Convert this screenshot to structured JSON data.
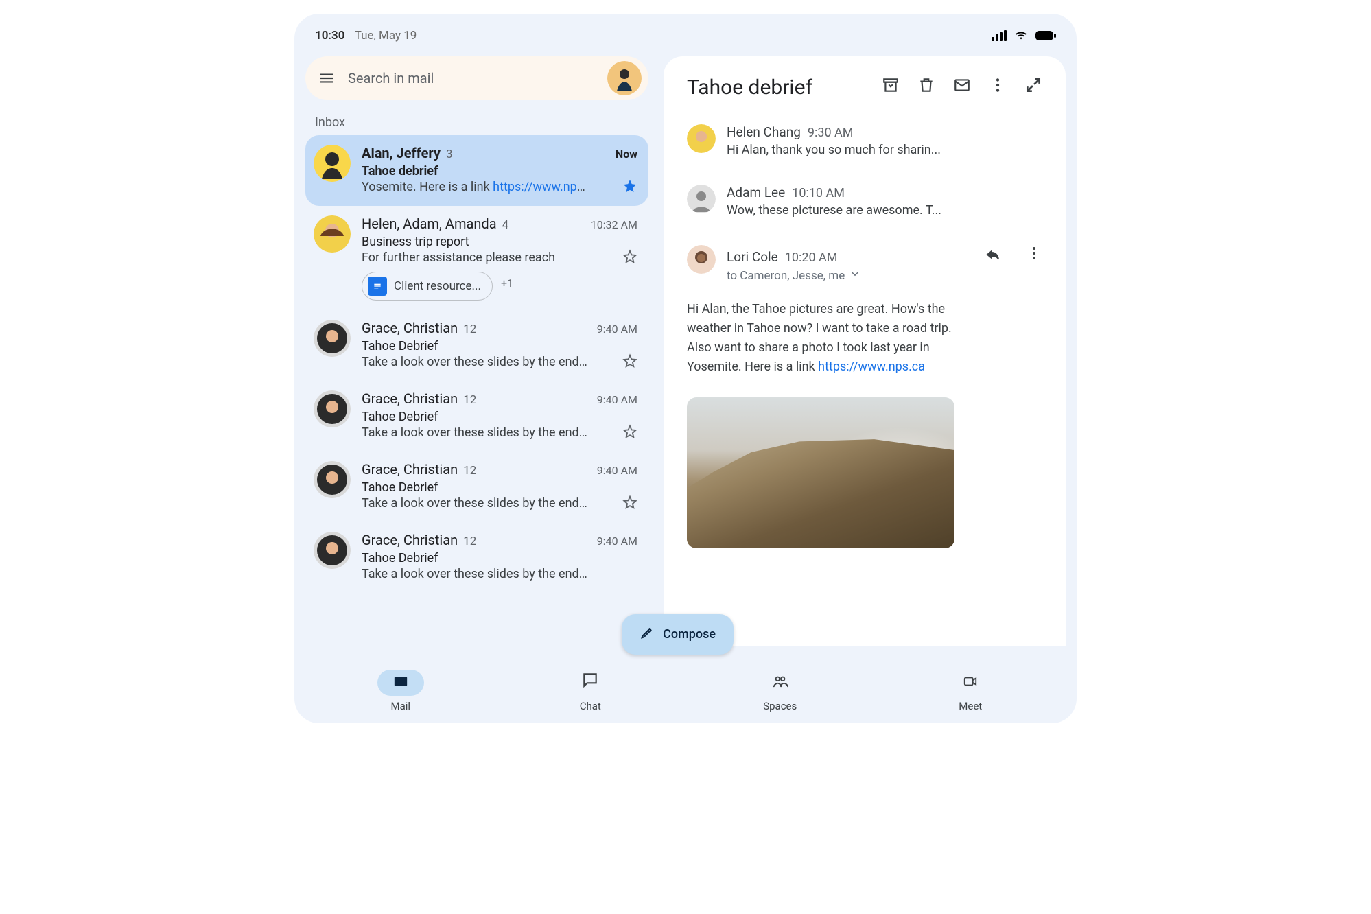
{
  "status": {
    "time": "10:30",
    "date": "Tue, May 19"
  },
  "search": {
    "placeholder": "Search in mail"
  },
  "section": "Inbox",
  "compose": "Compose",
  "threads": [
    {
      "names": "Alan, Jeffery",
      "count": "3",
      "subject": "Tahoe debrief",
      "preview_prefix": "Yosemite. Here is a link ",
      "preview_link": "https://www.nps...",
      "time": "Now",
      "selected": true,
      "starred": true
    },
    {
      "names": "Helen, Adam, Amanda",
      "count": "4",
      "subject": "Business trip report",
      "preview": "For further assistance please reach",
      "time": "10:32 AM",
      "attachment": "Client resource...",
      "plus_more": "+1"
    },
    {
      "names": "Grace, Christian",
      "count": "12",
      "subject": "Tahoe Debrief",
      "preview": "Take a look over these slides by the end...",
      "time": "9:40 AM"
    },
    {
      "names": "Grace, Christian",
      "count": "12",
      "subject": "Tahoe Debrief",
      "preview": "Take a look over these slides by the end...",
      "time": "9:40 AM"
    },
    {
      "names": "Grace, Christian",
      "count": "12",
      "subject": "Tahoe Debrief",
      "preview": "Take a look over these slides by the end...",
      "time": "9:40 AM"
    },
    {
      "names": "Grace, Christian",
      "count": "12",
      "subject": "Tahoe Debrief",
      "preview": "Take a look over these slides by the end...",
      "time": "9:40 AM"
    }
  ],
  "open_thread": {
    "title": "Tahoe debrief",
    "messages": [
      {
        "sender": "Helen Chang",
        "time": "9:30 AM",
        "snippet": "Hi Alan, thank you so much for sharin..."
      },
      {
        "sender": "Adam Lee",
        "time": "10:10 AM",
        "snippet": "Wow, these picturese are awesome. T..."
      },
      {
        "sender": "Lori Cole",
        "time": "10:20 AM",
        "recipients": "to Cameron, Jesse, me",
        "body_prefix": "Hi Alan, the Tahoe pictures are great. How's the weather in Tahoe now? I want to take a road trip. Also want to share a photo I took last year in Yosemite. Here is a link ",
        "body_link": "https://www.nps.ca"
      }
    ]
  },
  "nav": {
    "mail": "Mail",
    "chat": "Chat",
    "spaces": "Spaces",
    "meet": "Meet"
  },
  "colors": {
    "accent": "#1a73e8",
    "selected_bg": "#c3dbf7",
    "compose_bg": "#bedcf4"
  }
}
